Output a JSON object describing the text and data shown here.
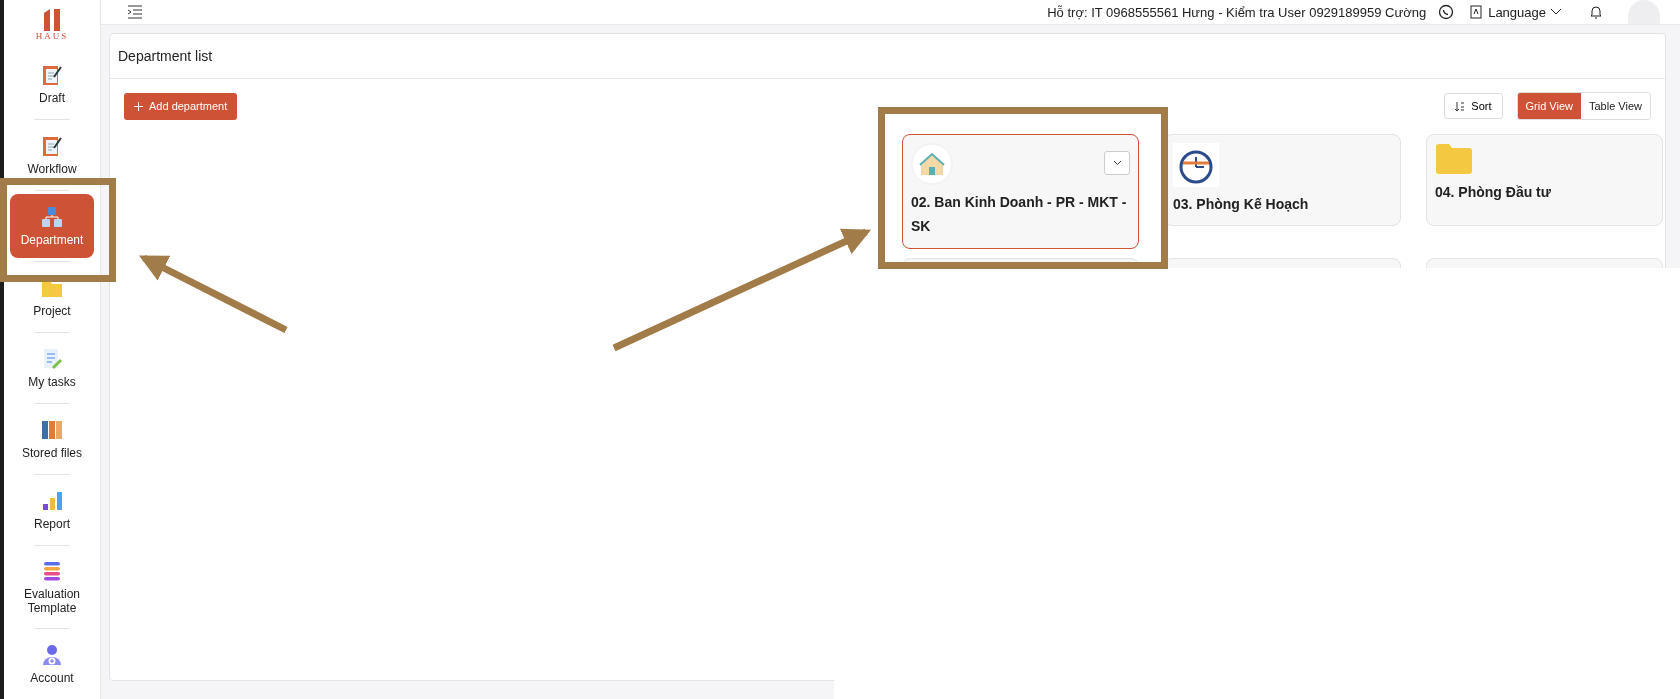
{
  "logo": {
    "text": "HAUS"
  },
  "sidebar": {
    "items": [
      {
        "label": "Draft",
        "kind": "draft",
        "selected": false
      },
      {
        "label": "Workflow",
        "kind": "workflow",
        "selected": false
      },
      {
        "label": "Department",
        "kind": "department",
        "selected": true
      },
      {
        "label": "Project",
        "kind": "project",
        "selected": false
      },
      {
        "label": "My tasks",
        "kind": "tasks",
        "selected": false
      },
      {
        "label": "Stored files",
        "kind": "files",
        "selected": false
      },
      {
        "label": "Report",
        "kind": "report",
        "selected": false
      },
      {
        "label": "Evaluation Template",
        "kind": "evaluation",
        "selected": false
      },
      {
        "label": "Account",
        "kind": "account",
        "selected": false
      }
    ]
  },
  "topbar": {
    "support": "Hỗ trợ: IT 0968555561 Hưng - Kiểm tra User 0929189959 Cường",
    "language": "Language"
  },
  "panel": {
    "title": "Department list",
    "add_button": "Add department",
    "sort_button": "Sort",
    "views": [
      {
        "label": "Grid View",
        "selected": true
      },
      {
        "label": "Table View",
        "selected": false
      }
    ]
  },
  "departments": [
    {
      "name": "02. Ban Kinh Doanh - PR - MKT -SK",
      "kind": "logo",
      "selected": true
    },
    {
      "name": "03. Phòng Kế Hoạch",
      "kind": "project-logo",
      "selected": false
    },
    {
      "name": "04. Phòng Đầu tư",
      "kind": "folder",
      "selected": false
    }
  ]
}
